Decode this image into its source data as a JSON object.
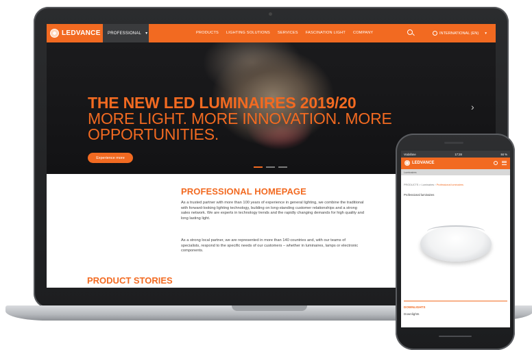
{
  "laptop_site": {
    "brand": "LEDVANCE",
    "professional_tab": "PROFESSIONAL",
    "nav_links": [
      "PRODUCTS",
      "LIGHTING SOLUTIONS",
      "SERVICES",
      "FASCINATION LIGHT",
      "COMPANY"
    ],
    "language": "INTERNATIONAL (EN)",
    "hero": {
      "line1": "THE NEW LED LUMINAIRES 2019/20",
      "line2": "MORE LIGHT. MORE INNOVATION. MORE",
      "line3": "OPPORTUNITIES.",
      "button": "Experience more",
      "next_arrow": "›"
    },
    "section_title": "PROFESSIONAL HOMEPAGE",
    "paragraph1": "As a trusted partner with more than 100 years of experience in general lighting, we combine the traditional with forward-looking lighting technology, building on long-standing customer relationships and a strong sales network. We are experts in technology trends and the rapidly changing demands for high quality and long lasting light.",
    "paragraph2": "As a strong local partner, we are represented in more than 140 countries and, with our teams of specialists, respond to the specific needs of our customers – whether in luminaires, lamps or electronic components.",
    "product_stories": "PRODUCT STORIES"
  },
  "phone_site": {
    "status_left": "Vodafone",
    "status_time": "17:28",
    "status_right": "84 %",
    "brand": "LEDVANCE",
    "sub_bar": "Luminaires",
    "breadcrumb_base": "PRODUCTS > Luminaires",
    "breadcrumb_active": "Professional luminaires",
    "product_label": "Professional luminaires",
    "category": "DOWNLIGHTS",
    "category_item": "Downlights"
  },
  "colors": {
    "accent": "#f26a21",
    "dark_nav": "#3a3b3d"
  }
}
